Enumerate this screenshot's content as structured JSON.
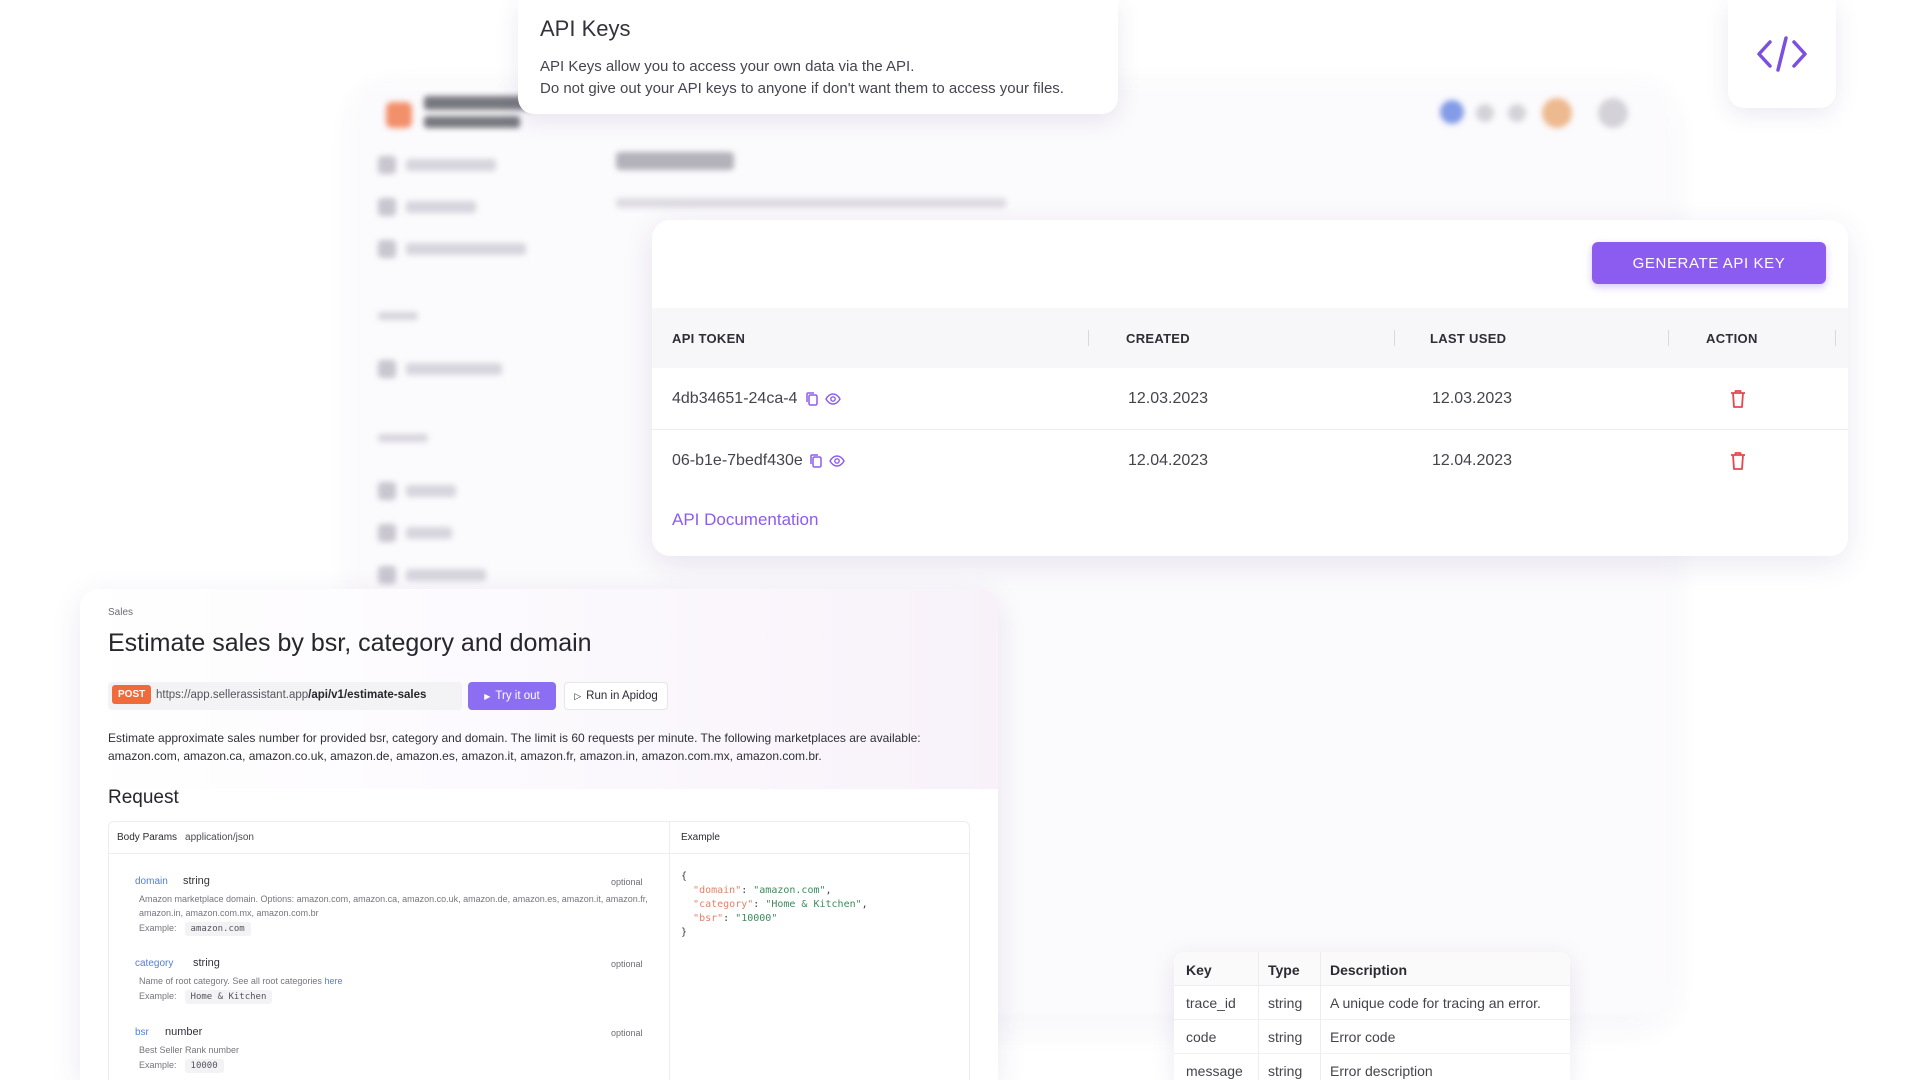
{
  "info_card": {
    "title": "API Keys",
    "line1": "API Keys allow you to access your own data via the API.",
    "line2": "Do not give out your API keys to anyone if don't want them to access your files."
  },
  "code_icon": "code-brackets-icon",
  "keys_table": {
    "generate_label": "GENERATE API KEY",
    "headers": {
      "token": "API TOKEN",
      "created": "CREATED",
      "last_used": "LAST USED",
      "action": "ACTION"
    },
    "rows": [
      {
        "token": "4db34651-24ca-4",
        "created": "12.03.2023",
        "last_used": "12.03.2023"
      },
      {
        "token": "06-b1e-7bedf430e",
        "created": "12.04.2023",
        "last_used": "12.04.2023"
      }
    ],
    "doc_link": "API Documentation",
    "accent": "#8c5cf0",
    "delete_color": "#e5484d"
  },
  "doc": {
    "section": "Sales",
    "title": "Estimate sales by bsr, category and domain",
    "method": "POST",
    "url_base": "https://app.sellerassistant.app",
    "url_path": "/api/v1/estimate-sales",
    "try_label": "Try it out",
    "apidog_label": "Run in Apidog",
    "description": "Estimate approximate sales number for provided bsr, category and domain. The limit is 60 requests per minute. The following marketplaces are available: amazon.com, amazon.ca, amazon.co.uk, amazon.de, amazon.es, amazon.it, amazon.fr, amazon.in, amazon.com.mx, amazon.com.br.",
    "request_title": "Request",
    "body_params_label": "Body Params",
    "content_type": "application/json",
    "example_label": "Example",
    "params": [
      {
        "name": "domain",
        "type": "string",
        "optional": "optional",
        "desc": "Amazon marketplace domain. Options: amazon.com, amazon.ca, amazon.co.uk, amazon.de, amazon.es, amazon.it, amazon.fr, amazon.in, amazon.com.mx, amazon.com.br",
        "example_label": "Example:",
        "example": "amazon.com"
      },
      {
        "name": "category",
        "type": "string",
        "optional": "optional",
        "desc": "Name of root category. See all root categories",
        "link": "here",
        "example_label": "Example:",
        "example": "Home & Kitchen"
      },
      {
        "name": "bsr",
        "type": "number",
        "optional": "optional",
        "desc": "Best Seller Rank number",
        "example_label": "Example:",
        "example": "10000"
      }
    ],
    "code": {
      "open": "{",
      "lines": [
        {
          "key": "\"domain\"",
          "value": "\"amazon.com\"",
          "trail": ","
        },
        {
          "key": "\"category\"",
          "value": "\"Home & Kitchen\"",
          "trail": ","
        },
        {
          "key": "\"bsr\"",
          "value": "\"10000\"",
          "trail": ""
        }
      ],
      "close": "}"
    }
  },
  "error_table": {
    "headers": {
      "key": "Key",
      "type": "Type",
      "description": "Description"
    },
    "rows": [
      {
        "key": "trace_id",
        "type": "string",
        "description": "A unique code for tracing an error."
      },
      {
        "key": "code",
        "type": "string",
        "description": "Error code"
      },
      {
        "key": "message",
        "type": "string",
        "description": "Error description"
      }
    ]
  }
}
